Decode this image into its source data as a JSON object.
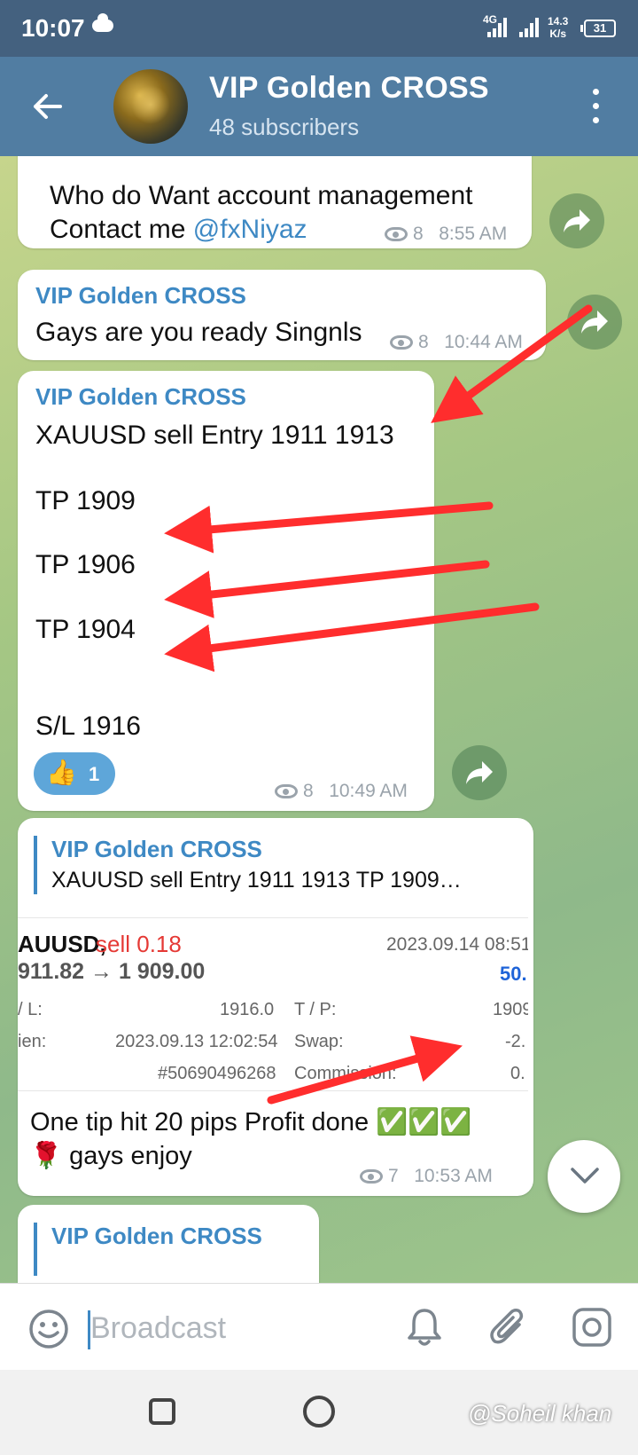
{
  "status_bar": {
    "time": "10:07",
    "network": "4G",
    "speed_value": "14.3",
    "speed_unit": "K/s",
    "battery": "31"
  },
  "header": {
    "title": "VIP Golden CROSS",
    "subtitle": "48 subscribers",
    "back_icon": "arrow-left-icon",
    "menu_icon": "more-vertical-icon"
  },
  "messages": [
    {
      "text_line1": "Who do Want account management",
      "text_prefix": "Contact me ",
      "link": "@fxNiyaz",
      "views": "8",
      "time": "8:55 AM"
    },
    {
      "sender": "VIP Golden CROSS",
      "text": "Gays are you ready Singnls",
      "views": "8",
      "time": "10:44 AM"
    },
    {
      "sender": "VIP Golden CROSS",
      "lines": [
        "XAUUSD sell Entry 1911 1913",
        "TP 1909",
        "TP 1906",
        "TP 1904",
        "S/L 1916"
      ],
      "reaction_emoji": "👍",
      "reaction_count": "1",
      "views": "8",
      "time": "10:49 AM"
    },
    {
      "reply_sender": "VIP Golden CROSS",
      "reply_text": "XAUUSD sell Entry 1911 1913  TP 1909…",
      "trade": {
        "symbol": "AUUSD,",
        "side": "sell 0.18",
        "datetime": "2023.09.14 08:51:",
        "prices": "911.82 → 1 909.00",
        "profit": "50.",
        "sl_label": "/ L:",
        "sl_value": "1916.0",
        "tp_label": "T / P:",
        "tp_value": "1909",
        "open_label": "ien:",
        "open_value": "2023.09.13 12:02:54",
        "swap_label": "Swap:",
        "swap_value": "-2.",
        "ticket": "#50690496268",
        "commission_label": "Commission:",
        "commission_value": "0."
      },
      "text_line1": "One tip hit 20 pips Profit done ✅✅✅",
      "text_line2": "🌹 gays enjoy",
      "views": "7",
      "time": "10:53 AM"
    },
    {
      "sender": "VIP Golden CROSS"
    }
  ],
  "input": {
    "placeholder": "Broadcast"
  },
  "watermark": "@Soheil khan",
  "colors": {
    "header": "#517da2",
    "status_bar": "#44617f",
    "link": "#3e89c4",
    "annotation_arrow": "#ff2d2d",
    "sell": "#e53935",
    "profit": "#1e63d8"
  }
}
